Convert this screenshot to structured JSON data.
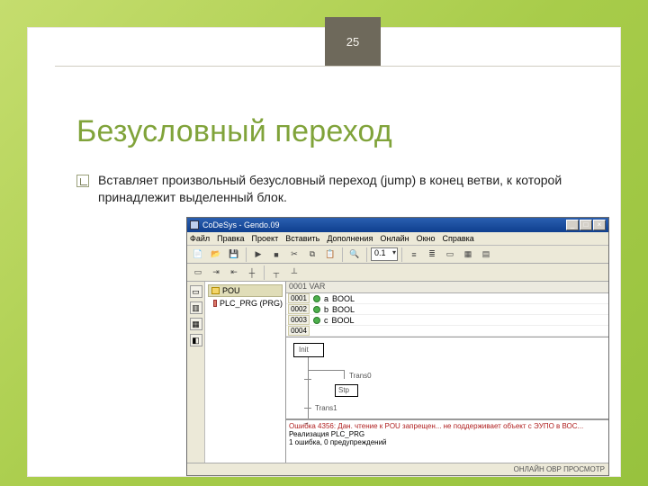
{
  "slide": {
    "page_number": "25",
    "title": "Безусловный переход",
    "bullet": "Вставляет произвольный безусловный переход (jump) в конец ветви, к которой принадлежит выделенный блок."
  },
  "app": {
    "title": "CoDeSys - Gendo.09",
    "menus": [
      "Файл",
      "Правка",
      "Проект",
      "Вставить",
      "Дополнения",
      "Онлайн",
      "Окно",
      "Справка"
    ],
    "window_controls": {
      "min": "_",
      "max": "□",
      "close": "×"
    },
    "toolbar": {
      "combo_value": "0.1"
    },
    "tree": {
      "root": "POU",
      "item": "PLC_PRG (PRG)"
    },
    "vars": {
      "header": "0001 VAR",
      "rows": [
        {
          "id": "0001",
          "name": "a",
          "type": "BOOL"
        },
        {
          "id": "0002",
          "name": "b",
          "type": "BOOL"
        },
        {
          "id": "0003",
          "name": "c",
          "type": "BOOL"
        }
      ],
      "footer": "0004"
    },
    "diagram": {
      "init": "Init",
      "trans1": "Trans0",
      "step": "Stp",
      "trans2": "Trans1"
    },
    "console": {
      "line1": "Ошибка 4356: Дан. чтение к POU запрещен... не поддерживает объект с ЭУПО в ВОС...",
      "line2": "Реализация PLC_PRG",
      "line3": "1 ошибка, 0 предупреждений"
    },
    "status": "ОНЛАЙН  OВР  ПРОСМОТР"
  }
}
